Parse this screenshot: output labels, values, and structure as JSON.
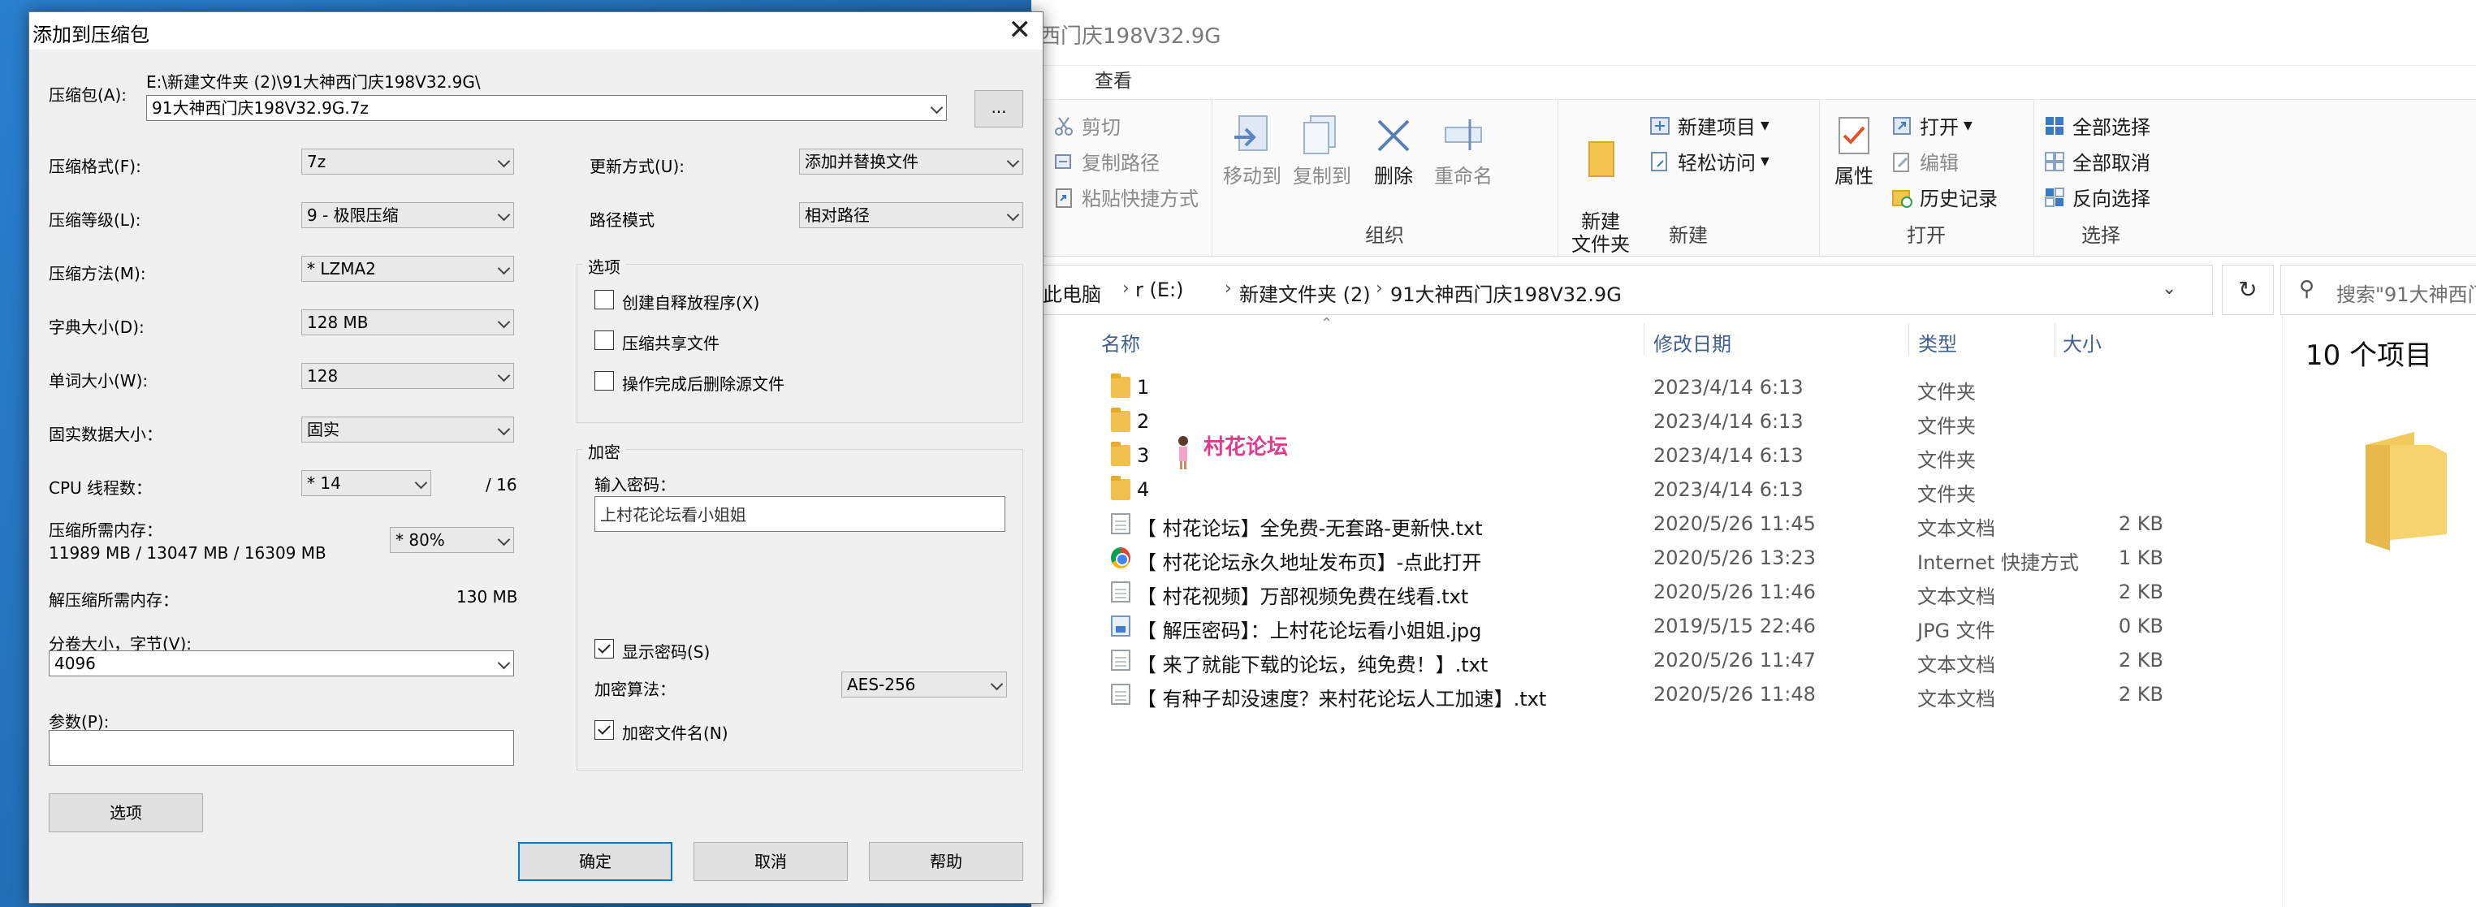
{
  "explorer": {
    "title": "西门庆198V32.9G",
    "tab_view": "查看",
    "ribbon": {
      "clipboard": {
        "cut": "剪切",
        "copy_path": "复制路径",
        "paste_shortcut": "粘贴快捷方式"
      },
      "organize": {
        "label": "组织",
        "move_to": "移动到",
        "copy_to": "复制到",
        "delete": "删除",
        "rename": "重命名"
      },
      "new": {
        "label": "新建",
        "new_folder": "新建\n文件夹",
        "new_item": "新建项目",
        "easy_access": "轻松访问"
      },
      "open": {
        "label": "打开",
        "properties": "属性",
        "open": "打开",
        "edit": "编辑",
        "history": "历史记录"
      },
      "select": {
        "label": "选择",
        "select_all": "全部选择",
        "select_none": "全部取消",
        "invert": "反向选择"
      }
    },
    "address": {
      "crumbs": [
        "此电脑",
        "r (E:)",
        "新建文件夹 (2)",
        "91大神西门庆198V32.9G"
      ]
    },
    "search_placeholder": "搜索\"91大神西门",
    "columns": {
      "name": "名称",
      "date": "修改日期",
      "type": "类型",
      "size": "大小"
    },
    "files": [
      {
        "name": "1",
        "date": "2023/4/14 6:13",
        "type": "文件夹",
        "size": "",
        "icon": "folder-icon"
      },
      {
        "name": "2",
        "date": "2023/4/14 6:13",
        "type": "文件夹",
        "size": "",
        "icon": "folder-icon"
      },
      {
        "name": "3",
        "date": "2023/4/14 6:13",
        "type": "文件夹",
        "size": "",
        "icon": "folder-icon"
      },
      {
        "name": "4",
        "date": "2023/4/14 6:13",
        "type": "文件夹",
        "size": "",
        "icon": "folder-icon"
      },
      {
        "name": "【 村花论坛】全免费-无套路-更新快.txt",
        "date": "2020/5/26 11:45",
        "type": "文本文档",
        "size": "2 KB",
        "icon": "text-file-icon"
      },
      {
        "name": "【 村花论坛永久地址发布页】-点此打开",
        "date": "2020/5/26 13:23",
        "type": "Internet 快捷方式",
        "size": "1 KB",
        "icon": "chrome-icon"
      },
      {
        "name": "【 村花视频】万部视频免费在线看.txt",
        "date": "2020/5/26 11:46",
        "type": "文本文档",
        "size": "2 KB",
        "icon": "text-file-icon"
      },
      {
        "name": "【 解压密码】：上村花论坛看小姐姐.jpg",
        "date": "2019/5/15 22:46",
        "type": "JPG 文件",
        "size": "0 KB",
        "icon": "image-file-icon"
      },
      {
        "name": "【 来了就能下载的论坛，纯免费！】.txt",
        "date": "2020/5/26 11:47",
        "type": "文本文档",
        "size": "2 KB",
        "icon": "text-file-icon"
      },
      {
        "name": "【 有种子却没速度？来村花论坛人工加速】.txt",
        "date": "2020/5/26 11:48",
        "type": "文本文档",
        "size": "2 KB",
        "icon": "text-file-icon"
      }
    ],
    "watermark": "村花论坛",
    "item_count": "10 个项目"
  },
  "dialog": {
    "title": "添加到压缩包",
    "archive_label": "压缩包(A):",
    "archive_dir": "E:\\新建文件夹 (2)\\91大神西门庆198V32.9G\\",
    "archive_name": "91大神西门庆198V32.9G.7z",
    "browse": "...",
    "format_label": "压缩格式(F):",
    "format_value": "7z",
    "level_label": "压缩等级(L):",
    "level_value": "9 - 极限压缩",
    "method_label": "压缩方法(M):",
    "method_value": "* LZMA2",
    "dict_label": "字典大小(D):",
    "dict_value": "128 MB",
    "word_label": "单词大小(W):",
    "word_value": "128",
    "solid_label": "固实数据大小：",
    "solid_value": "固实",
    "cpu_label": "CPU 线程数：",
    "cpu_value": "* 14",
    "cpu_total": "/ 16",
    "mem_comp_label": "压缩所需内存：",
    "mem_comp_value": "11989 MB / 13047 MB / 16309 MB",
    "mem_percent": "* 80%",
    "mem_decomp_label": "解压缩所需内存：",
    "mem_decomp_value": "130 MB",
    "split_label": "分卷大小，字节(V):",
    "split_value": "4096",
    "params_label": "参数(P):",
    "params_value": "",
    "options_button": "选项",
    "update_label": "更新方式(U):",
    "update_value": "添加并替换文件",
    "path_label": "路径模式",
    "path_value": "相对路径",
    "options_group": "选项",
    "opt_sfx": "创建自释放程序(X)",
    "opt_shared": "压缩共享文件",
    "opt_delete": "操作完成后删除源文件",
    "enc_group": "加密",
    "enc_pw_label": "输入密码：",
    "enc_pw_value": "上村花论坛看小姐姐",
    "enc_show": "显示密码(S)",
    "enc_method_label": "加密算法：",
    "enc_method_value": "AES-256",
    "enc_names": "加密文件名(N)",
    "ok": "确定",
    "cancel": "取消",
    "help": "帮助"
  }
}
